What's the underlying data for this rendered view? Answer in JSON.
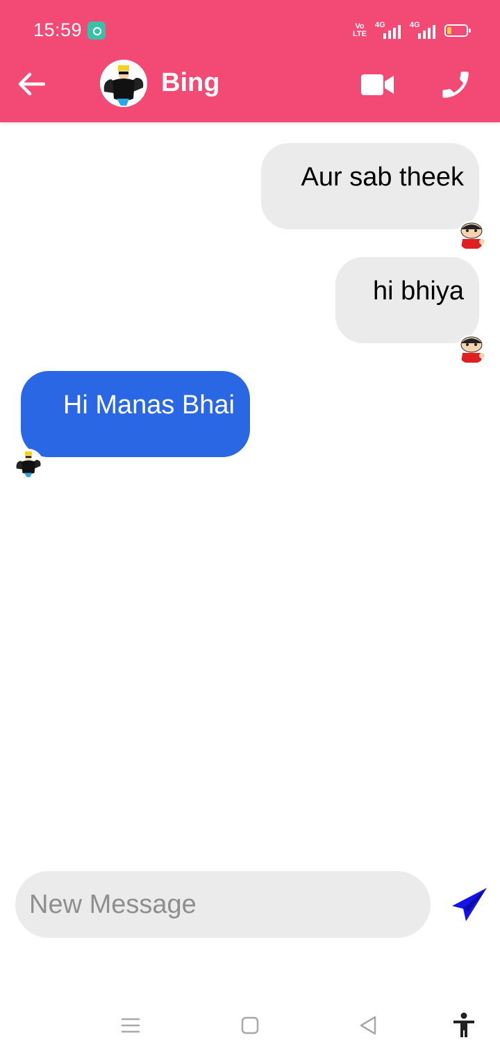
{
  "status_bar": {
    "time": "15:59",
    "volte_label": "VoLTE 2",
    "network_1": "4G",
    "network_2": "4G",
    "battery_color": "#FFC83D"
  },
  "header": {
    "back_icon": "arrow-left-icon",
    "contact_name": "Bing",
    "avatar_icon": "johnny-bravo-avatar",
    "video_icon": "video-camera-icon",
    "call_icon": "phone-icon",
    "background_color": "#F24A74"
  },
  "messages": [
    {
      "direction": "sent",
      "text": "Aur sab theek",
      "avatar": "shinchan-avatar"
    },
    {
      "direction": "sent",
      "text": "hi bhiya",
      "avatar": "shinchan-avatar"
    },
    {
      "direction": "received",
      "text": "Hi Manas Bhai",
      "avatar": "johnny-bravo-avatar"
    }
  ],
  "colors": {
    "sent_bubble": "#EBEBEB",
    "received_bubble": "#2A67E5",
    "send_icon": "#1414E6"
  },
  "composer": {
    "placeholder": "New Message",
    "value": "",
    "send_icon": "paper-plane-icon"
  },
  "nav_bar": {
    "icons": [
      "menu-icon",
      "home-icon",
      "back-triangle-icon",
      "accessibility-icon"
    ]
  }
}
